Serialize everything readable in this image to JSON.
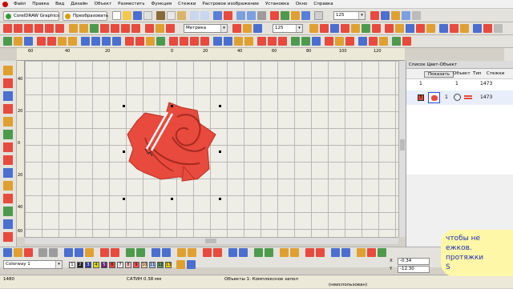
{
  "menu": {
    "items": [
      "Файл",
      "Правка",
      "Вид",
      "Дизайн",
      "Объект",
      "Разместить",
      "Функция",
      "Стежки",
      "Растровое изображение",
      "Установка",
      "Окно",
      "Справка"
    ]
  },
  "toolbar1": {
    "coreldraw_label": "CorelDRAW Graphics",
    "convert_label": "Преобразовать",
    "zoom_value": "125"
  },
  "toolbar2": {
    "units_value": "Метрика",
    "zoom_value": "125"
  },
  "ruler": {
    "h_ticks": [
      "60",
      "40",
      "20",
      "0",
      "20",
      "40",
      "60",
      "80",
      "100",
      "120"
    ],
    "v_ticks": [
      "40",
      "20",
      "0",
      "20",
      "40",
      "60"
    ]
  },
  "panel": {
    "title": "Список Цвет-Объект",
    "show_label": "Показать",
    "col_objects": "Объект",
    "col_type": "Тип",
    "col_stitches": "Стежки",
    "row_group": {
      "index": "1",
      "stitches": "1473"
    },
    "row_object": {
      "color_num": "5",
      "index": "1",
      "stitches": "1473"
    }
  },
  "colors": {
    "accent_red": "#e84a3d",
    "swatches": [
      "#f5f5f5",
      "#222222",
      "#2a3aa8",
      "#e0e000",
      "#6b1f7a",
      "#e84a3d",
      "#efefef",
      "#f8c7c7",
      "#ff5555",
      "#ffd7a8",
      "#aac8ff",
      "#5d9e5d",
      "#ffd700"
    ]
  },
  "bottom": {
    "colorway_value": "Colorway 1",
    "swatch_labels": [
      "1",
      "2",
      "3",
      "4",
      "5",
      "6",
      "7",
      "8",
      "9",
      "10",
      "11",
      "12",
      "13"
    ],
    "x_value": "-0.34",
    "y_value": "-12.30"
  },
  "status": {
    "stitch_count": "1480",
    "stitch_type": "САТИН  0.38 мм",
    "objects": "Объекты 1: Комплексное запол",
    "unused": "(неиспользован)"
  },
  "overlay": {
    "line1": "чтобы не",
    "line2": "ежков.",
    "line3": "протяжки",
    "line4": "S"
  }
}
